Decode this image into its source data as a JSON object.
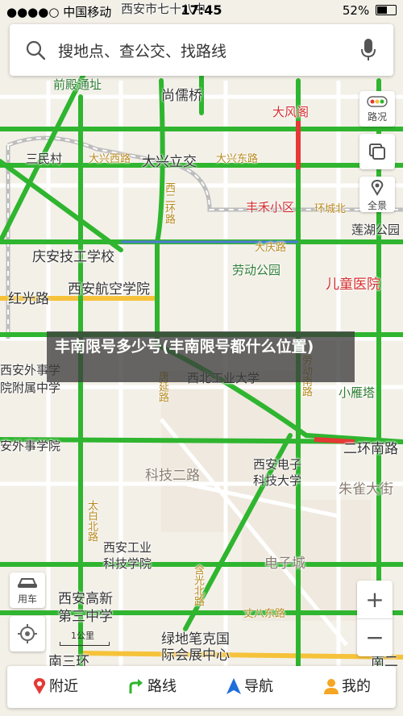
{
  "status_bar": {
    "carrier": "●●●●○ 中国移动",
    "time": "17:45",
    "battery": "52%"
  },
  "search": {
    "placeholder": "搜地点、查公交、找路线"
  },
  "map_labels": {
    "top_road": "西安市七十八中",
    "qianjin": "前殿通址",
    "shangruqiao": "尚儒桥",
    "dafengge": "大风阁",
    "sanmincun": "三民村",
    "daxingxilu": "大兴西路",
    "daxinglijiao": "大兴立交",
    "daxingdonglu": "大兴东路",
    "xierhuan": "西二环路",
    "fengyuhuxiaoqu": "丰禾小区",
    "huanchengbei": "环城北",
    "lianhugongyuan": "莲湖公园",
    "qingan": "庆安技工学校",
    "dajinglu": "大庆路",
    "laodonggongyuan": "劳动公园",
    "ertongyiyuan": "儿童医院",
    "xian_hangkong": "西安航空学院",
    "hongguang": "红光路",
    "xibei_gongye": "西北工业大学",
    "xianwaishi1": "西安外事学",
    "xianwaishi2": "院附属中学",
    "xiaoyanta": "小雁塔",
    "xianwaishixueyuan": "安外事学院",
    "tangyan": "唐延路",
    "nanerhuan": "二环南路",
    "keji_erlu": "科技二路",
    "xian_dianzi1": "西安电子",
    "xian_dianzi2": "科技大学",
    "zhuquedajie": "朱雀大街",
    "taibai": "太白北路",
    "xian_gongye1": "西安工业",
    "xian_gongye2": "科技学院",
    "dianzicheng": "电子城",
    "xian_gaoxin1": "西安高新",
    "xian_gaoxin2": "第三中学",
    "lvdi": "绿地笔克国",
    "huizhan": "际会展中心",
    "zhangbadong": "丈八东路",
    "nansanhuan": "南三环",
    "nanerhuan_right": "南二",
    "hanguang": "含光北路",
    "laodongnan": "劳动南路"
  },
  "caption": "丰南限号多少号(丰南限号都什么位置)",
  "controls": {
    "traffic": "路况",
    "panorama": "全景",
    "car": "用车",
    "zoom_in": "+",
    "zoom_out": "−"
  },
  "scale": "1公里",
  "bottom_tabs": [
    {
      "label": "附近",
      "icon": "pin-icon"
    },
    {
      "label": "路线",
      "icon": "route-icon"
    },
    {
      "label": "导航",
      "icon": "navigation-icon"
    },
    {
      "label": "我的",
      "icon": "user-icon"
    }
  ],
  "colors": {
    "green_road": "#2fb52f",
    "red_road": "#e53935",
    "yellow_road": "#f5c23a",
    "land": "#f3f0e8"
  }
}
